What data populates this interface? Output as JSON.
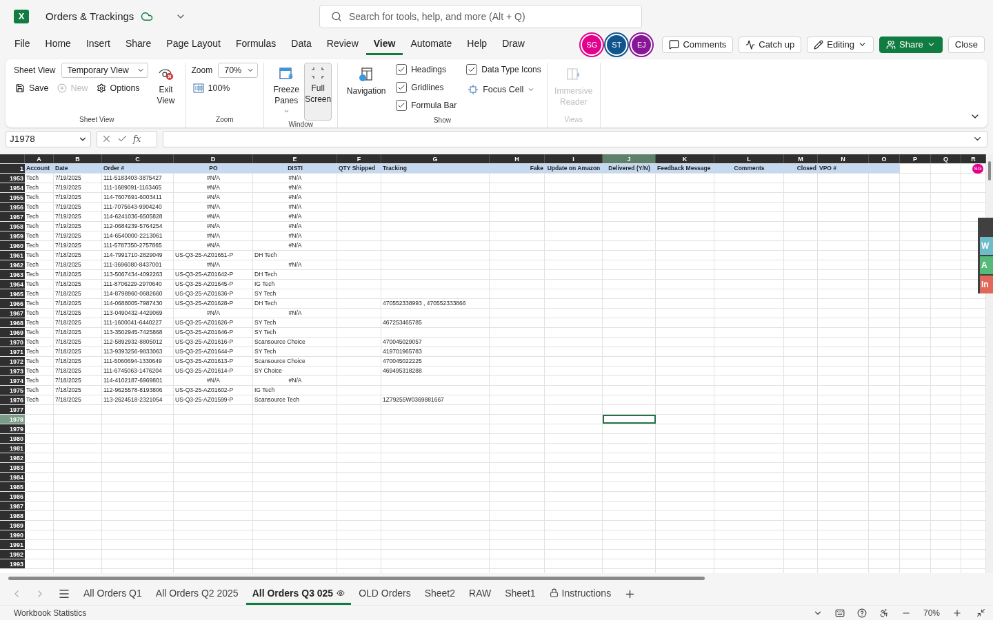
{
  "app": {
    "logo_letter": "X",
    "title": "Orders & Trackings",
    "search_placeholder": "Search for tools, help, and more (Alt + Q)"
  },
  "menu": [
    {
      "label": "File",
      "selected": false
    },
    {
      "label": "Home",
      "selected": false
    },
    {
      "label": "Insert",
      "selected": false
    },
    {
      "label": "Share",
      "selected": false
    },
    {
      "label": "Page Layout",
      "selected": false
    },
    {
      "label": "Formulas",
      "selected": false
    },
    {
      "label": "Data",
      "selected": false
    },
    {
      "label": "Review",
      "selected": false
    },
    {
      "label": "View",
      "selected": true
    },
    {
      "label": "Automate",
      "selected": false
    },
    {
      "label": "Help",
      "selected": false
    },
    {
      "label": "Draw",
      "selected": false
    }
  ],
  "collaborators": [
    {
      "initials": "SG",
      "color": "#e3008c"
    },
    {
      "initials": "ST",
      "color": "#0f548c"
    },
    {
      "initials": "EJ",
      "color": "#881798"
    }
  ],
  "actions": [
    {
      "label": "Comments",
      "kind": "comments"
    },
    {
      "label": "Catch up",
      "kind": "catchup"
    },
    {
      "label": "Editing",
      "kind": "editing"
    },
    {
      "label": "Share",
      "kind": "share"
    },
    {
      "label": "Close",
      "kind": "close"
    }
  ],
  "ribbon": {
    "sheet_view": {
      "label": "Sheet View",
      "view": "Temporary View",
      "exit": "Exit View",
      "save": "Save",
      "new": "New",
      "new_disabled": true,
      "options": "Options",
      "group": "Sheet View"
    },
    "zoom": {
      "label": "Zoom",
      "value": "70%",
      "reset": "100%",
      "group": "Zoom"
    },
    "window": {
      "freeze": "Freeze Panes",
      "full_screen": "Full Screen",
      "full_screen_on": true,
      "group": "Window"
    },
    "show": {
      "navigation": "Navigation",
      "checks": [
        {
          "label": "Headings",
          "checked": true
        },
        {
          "label": "Gridlines",
          "checked": true
        },
        {
          "label": "Formula Bar",
          "checked": true
        },
        {
          "label": "Data Type Icons",
          "checked": true
        }
      ],
      "focus_cell": "Focus Cell",
      "group": "Show"
    },
    "views": {
      "reader": "Immersive Reader",
      "disabled": true,
      "group": "Views"
    }
  },
  "formula_bar": {
    "name_box": "J1978",
    "function_label": "fx"
  },
  "sheet": {
    "columns": [
      {
        "letter": "A",
        "selected": false
      },
      {
        "letter": "B",
        "selected": false
      },
      {
        "letter": "C",
        "selected": false
      },
      {
        "letter": "D",
        "selected": false
      },
      {
        "letter": "E",
        "selected": false
      },
      {
        "letter": "F",
        "selected": false
      },
      {
        "letter": "G",
        "selected": false
      },
      {
        "letter": "H",
        "selected": false
      },
      {
        "letter": "I",
        "selected": false
      },
      {
        "letter": "J",
        "selected": true
      },
      {
        "letter": "K",
        "selected": false
      },
      {
        "letter": "L",
        "selected": false
      },
      {
        "letter": "M",
        "selected": false
      },
      {
        "letter": "N",
        "selected": false
      },
      {
        "letter": "O",
        "selected": false
      },
      {
        "letter": "P",
        "selected": false
      },
      {
        "letter": "Q",
        "selected": false
      },
      {
        "letter": "R",
        "selected": false
      }
    ],
    "header_row": {
      "number": "1",
      "cells": [
        "Account",
        "Date",
        "Order #",
        "PO",
        "DISTI",
        "QTY Shipped",
        "Tracking",
        "Fake",
        "Update on Amazon",
        "Delivered (Y/N)",
        "Feedback Message",
        "Comments",
        "Closed",
        "VPO #"
      ]
    },
    "presence": {
      "initials": "SG",
      "color": "#e3008c"
    },
    "rows": [
      {
        "number": "1953",
        "selected": false,
        "cells": {
          "A": {
            "text": "Tech",
            "kind": "text"
          },
          "B": {
            "text": "7/19/2025",
            "kind": "text"
          },
          "C": {
            "text": "111-5183403-3875427",
            "kind": "text"
          },
          "D": {
            "text": "#N/A",
            "kind": "error"
          },
          "E": {
            "text": "#N/A",
            "kind": "error"
          }
        }
      },
      {
        "number": "1954",
        "selected": false,
        "cells": {
          "A": {
            "text": "Tech",
            "kind": "text"
          },
          "B": {
            "text": "7/19/2025",
            "kind": "text"
          },
          "C": {
            "text": "111-1689091-1163465",
            "kind": "text"
          },
          "D": {
            "text": "#N/A",
            "kind": "error"
          },
          "E": {
            "text": "#N/A",
            "kind": "error"
          }
        }
      },
      {
        "number": "1955",
        "selected": false,
        "cells": {
          "A": {
            "text": "Tech",
            "kind": "text"
          },
          "B": {
            "text": "7/19/2025",
            "kind": "text"
          },
          "C": {
            "text": "114-7607691-6003411",
            "kind": "text"
          },
          "D": {
            "text": "#N/A",
            "kind": "error"
          },
          "E": {
            "text": "#N/A",
            "kind": "error"
          }
        }
      },
      {
        "number": "1956",
        "selected": false,
        "cells": {
          "A": {
            "text": "Tech",
            "kind": "text"
          },
          "B": {
            "text": "7/19/2025",
            "kind": "text"
          },
          "C": {
            "text": "111-7075643-9904240",
            "kind": "text"
          },
          "D": {
            "text": "#N/A",
            "kind": "error"
          },
          "E": {
            "text": "#N/A",
            "kind": "error"
          }
        }
      },
      {
        "number": "1957",
        "selected": false,
        "cells": {
          "A": {
            "text": "Tech",
            "kind": "text"
          },
          "B": {
            "text": "7/19/2025",
            "kind": "text"
          },
          "C": {
            "text": "114-6241036-6505828",
            "kind": "text"
          },
          "D": {
            "text": "#N/A",
            "kind": "error"
          },
          "E": {
            "text": "#N/A",
            "kind": "error"
          }
        }
      },
      {
        "number": "1958",
        "selected": false,
        "cells": {
          "A": {
            "text": "Tech",
            "kind": "text"
          },
          "B": {
            "text": "7/19/2025",
            "kind": "text"
          },
          "C": {
            "text": "112-0684239-5764254",
            "kind": "text"
          },
          "D": {
            "text": "#N/A",
            "kind": "error"
          },
          "E": {
            "text": "#N/A",
            "kind": "error"
          }
        }
      },
      {
        "number": "1959",
        "selected": false,
        "cells": {
          "A": {
            "text": "Tech",
            "kind": "text"
          },
          "B": {
            "text": "7/19/2025",
            "kind": "text"
          },
          "C": {
            "text": "114-6540000-2213061",
            "kind": "text"
          },
          "D": {
            "text": "#N/A",
            "kind": "error"
          },
          "E": {
            "text": "#N/A",
            "kind": "error"
          }
        }
      },
      {
        "number": "1960",
        "selected": false,
        "cells": {
          "A": {
            "text": "Tech",
            "kind": "text"
          },
          "B": {
            "text": "7/19/2025",
            "kind": "text"
          },
          "C": {
            "text": "111-5787350-2757865",
            "kind": "text"
          },
          "D": {
            "text": "#N/A",
            "kind": "error"
          },
          "E": {
            "text": "#N/A",
            "kind": "error"
          }
        }
      },
      {
        "number": "1961",
        "selected": false,
        "cells": {
          "A": {
            "text": "Tech",
            "kind": "text"
          },
          "B": {
            "text": "7/18/2025",
            "kind": "text"
          },
          "C": {
            "text": "114-7991710-2829049",
            "kind": "text"
          },
          "D": {
            "text": "US-Q3-25-AZ01651-P",
            "kind": "text"
          },
          "E": {
            "text": "DH Tech",
            "kind": "text"
          }
        }
      },
      {
        "number": "1962",
        "selected": false,
        "cells": {
          "A": {
            "text": "Tech",
            "kind": "text"
          },
          "B": {
            "text": "7/18/2025",
            "kind": "text"
          },
          "C": {
            "text": "111-3696080-8437001",
            "kind": "text"
          },
          "D": {
            "text": "#N/A",
            "kind": "error"
          },
          "E": {
            "text": "#N/A",
            "kind": "error"
          }
        }
      },
      {
        "number": "1963",
        "selected": false,
        "cells": {
          "A": {
            "text": "Tech",
            "kind": "text"
          },
          "B": {
            "text": "7/18/2025",
            "kind": "text"
          },
          "C": {
            "text": "113-5067434-4092263",
            "kind": "text"
          },
          "D": {
            "text": "US-Q3-25-AZ01642-P",
            "kind": "text"
          },
          "E": {
            "text": "DH Tech",
            "kind": "text"
          }
        }
      },
      {
        "number": "1964",
        "selected": false,
        "cells": {
          "A": {
            "text": "Tech",
            "kind": "text"
          },
          "B": {
            "text": "7/18/2025",
            "kind": "text"
          },
          "C": {
            "text": "111-8706229-2970640",
            "kind": "text"
          },
          "D": {
            "text": "US-Q3-25-AZ01645-P",
            "kind": "text"
          },
          "E": {
            "text": "IG Tech",
            "kind": "text"
          }
        }
      },
      {
        "number": "1965",
        "selected": false,
        "cells": {
          "A": {
            "text": "Tech",
            "kind": "text"
          },
          "B": {
            "text": "7/18/2025",
            "kind": "text"
          },
          "C": {
            "text": "114-8798960-0682660",
            "kind": "text"
          },
          "D": {
            "text": "US-Q3-25-AZ01636-P",
            "kind": "text"
          },
          "E": {
            "text": "SY Tech",
            "kind": "text"
          }
        }
      },
      {
        "number": "1966",
        "selected": false,
        "cells": {
          "A": {
            "text": "Tech",
            "kind": "text"
          },
          "B": {
            "text": "7/18/2025",
            "kind": "text"
          },
          "C": {
            "text": "114-0688005-7987430",
            "kind": "text"
          },
          "D": {
            "text": "US-Q3-25-AZ01628-P",
            "kind": "text"
          },
          "E": {
            "text": "DH Tech",
            "kind": "text"
          },
          "G": {
            "text": "470552338993 , 470552333866",
            "kind": "text"
          }
        }
      },
      {
        "number": "1967",
        "selected": false,
        "cells": {
          "A": {
            "text": "Tech",
            "kind": "text"
          },
          "B": {
            "text": "7/18/2025",
            "kind": "text"
          },
          "C": {
            "text": "113-0490432-4429069",
            "kind": "text"
          },
          "D": {
            "text": "#N/A",
            "kind": "error"
          },
          "E": {
            "text": "#N/A",
            "kind": "error"
          }
        }
      },
      {
        "number": "1968",
        "selected": false,
        "cells": {
          "A": {
            "text": "Tech",
            "kind": "text"
          },
          "B": {
            "text": "7/18/2025",
            "kind": "text"
          },
          "C": {
            "text": "111-1600041-6440227",
            "kind": "text"
          },
          "D": {
            "text": "US-Q3-25-AZ01626-P",
            "kind": "text"
          },
          "E": {
            "text": "SY Tech",
            "kind": "text"
          },
          "G": {
            "text": "467253465785",
            "kind": "text"
          }
        }
      },
      {
        "number": "1969",
        "selected": false,
        "cells": {
          "A": {
            "text": "Tech",
            "kind": "text"
          },
          "B": {
            "text": "7/18/2025",
            "kind": "text"
          },
          "C": {
            "text": "113-3502945-7425868",
            "kind": "text"
          },
          "D": {
            "text": "US-Q3-25-AZ01646-P",
            "kind": "text"
          },
          "E": {
            "text": "SY Tech",
            "kind": "text"
          }
        }
      },
      {
        "number": "1970",
        "selected": false,
        "cells": {
          "A": {
            "text": "Tech",
            "kind": "text"
          },
          "B": {
            "text": "7/18/2025",
            "kind": "text"
          },
          "C": {
            "text": "112-5892932-8805012",
            "kind": "text"
          },
          "D": {
            "text": "US-Q3-25-AZ01616-P",
            "kind": "text"
          },
          "E": {
            "text": "Scansource Choice",
            "kind": "text"
          },
          "G": {
            "text": "470045029057",
            "kind": "text"
          }
        }
      },
      {
        "number": "1971",
        "selected": false,
        "cells": {
          "A": {
            "text": "Tech",
            "kind": "text"
          },
          "B": {
            "text": "7/18/2025",
            "kind": "text"
          },
          "C": {
            "text": "113-9393256-9833063",
            "kind": "text"
          },
          "D": {
            "text": "US-Q3-25-AZ01644-P",
            "kind": "text"
          },
          "E": {
            "text": "SY Tech",
            "kind": "text"
          },
          "G": {
            "text": "419701965783",
            "kind": "text"
          }
        }
      },
      {
        "number": "1972",
        "selected": false,
        "cells": {
          "A": {
            "text": "Tech",
            "kind": "text"
          },
          "B": {
            "text": "7/18/2025",
            "kind": "text"
          },
          "C": {
            "text": "111-5060694-1330649",
            "kind": "text"
          },
          "D": {
            "text": "US-Q3-25-AZ01613-P",
            "kind": "text"
          },
          "E": {
            "text": "Scansource Choice",
            "kind": "text"
          },
          "G": {
            "text": "470045022225",
            "kind": "text"
          }
        }
      },
      {
        "number": "1973",
        "selected": false,
        "cells": {
          "A": {
            "text": "Tech",
            "kind": "text"
          },
          "B": {
            "text": "7/18/2025",
            "kind": "text"
          },
          "C": {
            "text": "111-6745063-1476204",
            "kind": "text"
          },
          "D": {
            "text": "US-Q3-25-AZ01614-P",
            "kind": "text"
          },
          "E": {
            "text": "SY Choice",
            "kind": "text"
          },
          "G": {
            "text": "469495318288",
            "kind": "text"
          }
        }
      },
      {
        "number": "1974",
        "selected": false,
        "cells": {
          "A": {
            "text": "Tech",
            "kind": "text"
          },
          "B": {
            "text": "7/18/2025",
            "kind": "text"
          },
          "C": {
            "text": "114-4102187-6969801",
            "kind": "text"
          },
          "D": {
            "text": "#N/A",
            "kind": "error"
          },
          "E": {
            "text": "#N/A",
            "kind": "error"
          }
        }
      },
      {
        "number": "1975",
        "selected": false,
        "cells": {
          "A": {
            "text": "Tech",
            "kind": "text"
          },
          "B": {
            "text": "7/18/2025",
            "kind": "text"
          },
          "C": {
            "text": "112-9625578-8193806",
            "kind": "text"
          },
          "D": {
            "text": "US-Q3-25-AZ01602-P",
            "kind": "text"
          },
          "E": {
            "text": "IG Tech",
            "kind": "text"
          }
        }
      },
      {
        "number": "1976",
        "selected": false,
        "cells": {
          "A": {
            "text": "Tech",
            "kind": "text"
          },
          "B": {
            "text": "7/18/2025",
            "kind": "text"
          },
          "C": {
            "text": "113-2624518-2321054",
            "kind": "text"
          },
          "D": {
            "text": "US-Q3-25-AZ01599-P",
            "kind": "text"
          },
          "E": {
            "text": "Scansource Tech",
            "kind": "text"
          },
          "G": {
            "text": "1Z79255W0369881667",
            "kind": "text"
          }
        }
      },
      {
        "number": "1977",
        "selected": false
      },
      {
        "number": "1978",
        "selected": true
      },
      {
        "number": "1979",
        "selected": false
      },
      {
        "number": "1980",
        "selected": false
      },
      {
        "number": "1981",
        "selected": false
      },
      {
        "number": "1982",
        "selected": false
      },
      {
        "number": "1983",
        "selected": false
      },
      {
        "number": "1984",
        "selected": false
      },
      {
        "number": "1985",
        "selected": false
      },
      {
        "number": "1986",
        "selected": false
      },
      {
        "number": "1987",
        "selected": false
      },
      {
        "number": "1988",
        "selected": false
      },
      {
        "number": "1989",
        "selected": false
      },
      {
        "number": "1990",
        "selected": false
      },
      {
        "number": "1991",
        "selected": false
      },
      {
        "number": "1992",
        "selected": false
      },
      {
        "number": "1993",
        "selected": false
      }
    ]
  },
  "side_tabs": [
    {
      "text": "W",
      "color": "#6dbcc7"
    },
    {
      "text": "A",
      "color": "#55b978"
    },
    {
      "text": "In",
      "color": "#e0685a"
    }
  ],
  "sheet_tabs": [
    {
      "label": "All Orders Q1",
      "selected": false,
      "kind": "plain"
    },
    {
      "label": "All Orders Q2 2025",
      "selected": false,
      "kind": "plain"
    },
    {
      "label": "All Orders Q3 025",
      "selected": true,
      "kind": "watched"
    },
    {
      "label": "OLD Orders",
      "selected": false,
      "kind": "plain"
    },
    {
      "label": "Sheet2",
      "selected": false,
      "kind": "plain"
    },
    {
      "label": "RAW",
      "selected": false,
      "kind": "plain"
    },
    {
      "label": "Sheet1",
      "selected": false,
      "kind": "plain"
    },
    {
      "label": "Instructions",
      "selected": false,
      "kind": "locked"
    }
  ],
  "status_bar": {
    "left": "Workbook Statistics",
    "zoom": "70%"
  }
}
